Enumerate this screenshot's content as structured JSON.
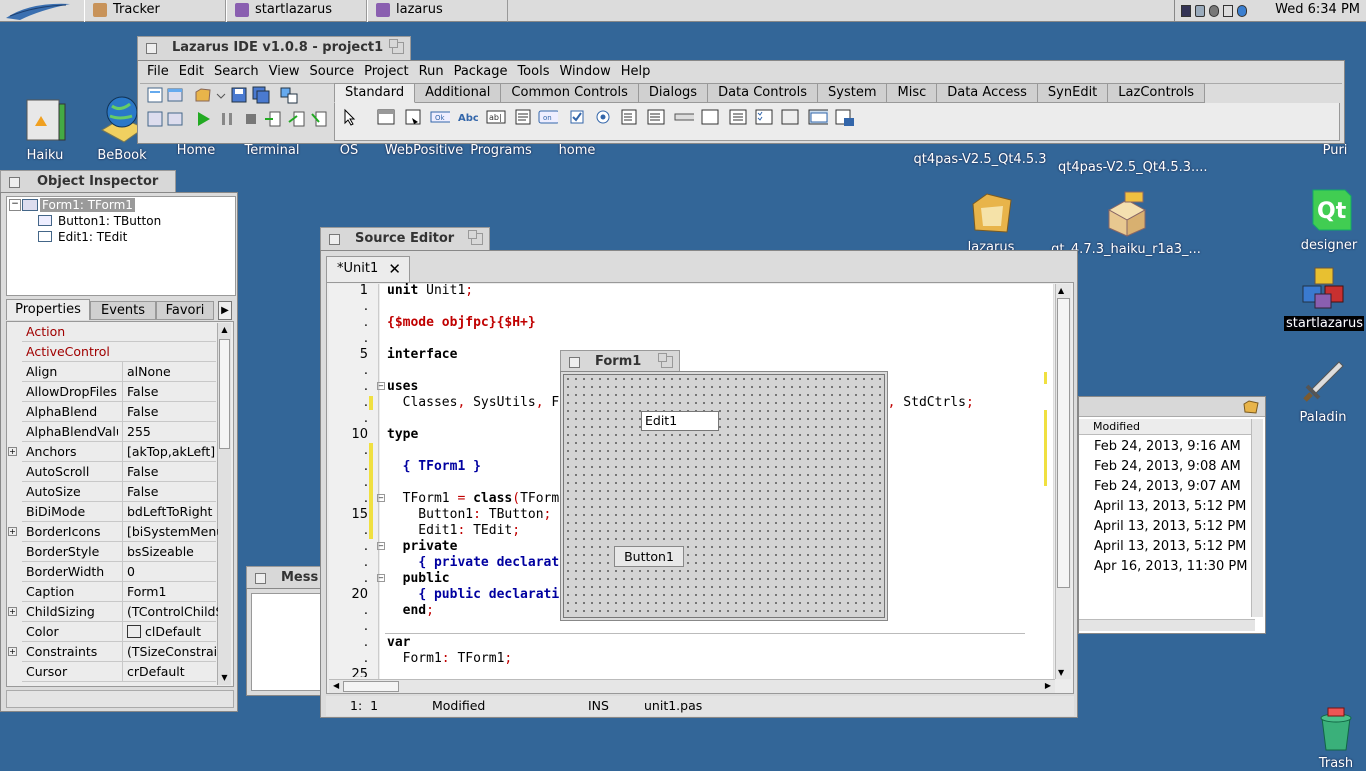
{
  "taskbar": {
    "tasks": [
      {
        "label": "Tracker",
        "icon": "tracker-icon"
      },
      {
        "label": "startlazarus",
        "icon": "app-icon"
      },
      {
        "label": "lazarus",
        "icon": "app-icon"
      }
    ],
    "clock": "Wed 6:34 PM"
  },
  "desktop": {
    "icons": [
      {
        "label": "Haiku",
        "icon": "haiku-disk-icon"
      },
      {
        "label": "BeBook",
        "icon": "bebook-icon"
      },
      {
        "label": "Home",
        "icon": "folder-icon"
      },
      {
        "label": "Terminal",
        "icon": "terminal-icon"
      },
      {
        "label": "OS",
        "icon": "folder-icon"
      },
      {
        "label": "WebPositive",
        "icon": "globe-icon"
      },
      {
        "label": "Programs",
        "icon": "folder-icon"
      },
      {
        "label": "home",
        "icon": "folder-icon"
      },
      {
        "label": "qt4pas-V2.5_Qt4.5.3",
        "icon": "package-icon"
      },
      {
        "label": "qt4pas-V2.5_Qt4.5.3....",
        "icon": "package-icon"
      },
      {
        "label": "Puri",
        "icon": "app-icon"
      },
      {
        "label": "lazarus",
        "icon": "folder-icon"
      },
      {
        "label": "qt_4.7.3_haiku_r1a3_...",
        "icon": "zip-icon"
      },
      {
        "label": "designer",
        "icon": "qt-icon"
      },
      {
        "label": "startlazarus",
        "icon": "cubes-icon"
      },
      {
        "label": "Paladin",
        "icon": "sword-icon"
      },
      {
        "label": "Trash",
        "icon": "trash-icon"
      }
    ]
  },
  "ide": {
    "title": "Lazarus IDE v1.0.8 - project1",
    "menu": [
      "File",
      "Edit",
      "Search",
      "View",
      "Source",
      "Project",
      "Run",
      "Package",
      "Tools",
      "Window",
      "Help"
    ],
    "palette_tabs": [
      "Standard",
      "Additional",
      "Common Controls",
      "Dialogs",
      "Data Controls",
      "System",
      "Misc",
      "Data Access",
      "SynEdit",
      "LazControls"
    ],
    "active_palette_tab": "Standard"
  },
  "object_inspector": {
    "title": "Object Inspector",
    "tree": [
      "Form1: TForm1",
      "Button1: TButton",
      "Edit1: TEdit"
    ],
    "tabs": [
      "Properties",
      "Events",
      "Favori"
    ],
    "properties": [
      {
        "name": "Action",
        "value": "",
        "red": true
      },
      {
        "name": "ActiveControl",
        "value": "",
        "red": true
      },
      {
        "name": "Align",
        "value": "alNone"
      },
      {
        "name": "AllowDropFiles",
        "value": "False"
      },
      {
        "name": "AlphaBlend",
        "value": "False"
      },
      {
        "name": "AlphaBlendValu",
        "value": "255"
      },
      {
        "name": "Anchors",
        "value": "[akTop,akLeft]",
        "expandable": true
      },
      {
        "name": "AutoScroll",
        "value": "False"
      },
      {
        "name": "AutoSize",
        "value": "False"
      },
      {
        "name": "BiDiMode",
        "value": "bdLeftToRight"
      },
      {
        "name": "BorderIcons",
        "value": "[biSystemMenu",
        "expandable": true
      },
      {
        "name": "BorderStyle",
        "value": "bsSizeable"
      },
      {
        "name": "BorderWidth",
        "value": "0"
      },
      {
        "name": "Caption",
        "value": "Form1"
      },
      {
        "name": "ChildSizing",
        "value": "(TControlChildSi",
        "expandable": true
      },
      {
        "name": "Color",
        "value": "clDefault"
      },
      {
        "name": "Constraints",
        "value": "(TSizeConstrain",
        "expandable": true
      },
      {
        "name": "Cursor",
        "value": "crDefault"
      }
    ]
  },
  "messages": {
    "title": "Mess"
  },
  "source_editor": {
    "title": "Source Editor",
    "tab": "*Unit1",
    "status": {
      "pos": "1:  1",
      "state": "Modified",
      "mode": "INS",
      "file": "unit1.pas"
    }
  },
  "form1": {
    "title": "Form1",
    "edit": "Edit1",
    "button": "Button1"
  },
  "tracker": {
    "column": "Modified",
    "rows": [
      "Feb 24, 2013, 9:16 AM",
      "Feb 24, 2013, 9:08 AM",
      "Feb 24, 2013, 9:07 AM",
      "April 13, 2013, 5:12 PM",
      "April 13, 2013, 5:12 PM",
      "April 13, 2013, 5:12 PM",
      "Apr 16, 2013, 11:30 PM"
    ]
  }
}
